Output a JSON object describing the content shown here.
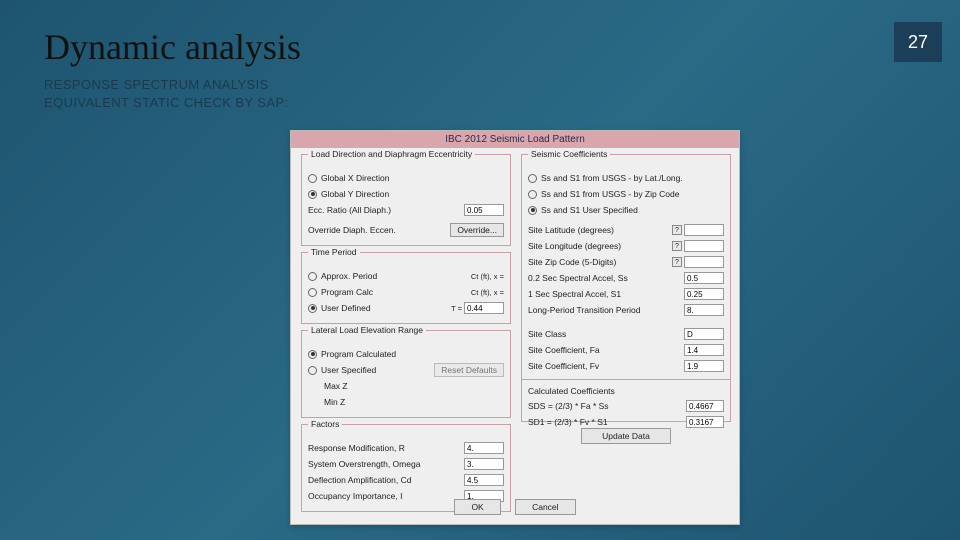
{
  "slide": {
    "title": "Dynamic analysis",
    "sub1": "RESPONSE SPECTRUM ANALYSIS",
    "sub2": "EQUIVALENT STATIC CHECK BY SAP:",
    "page": "27"
  },
  "dialog": {
    "title": "IBC 2012 Seismic Load Pattern",
    "left": {
      "dir_group": "Load Direction and Diaphragm Eccentricity",
      "dir_x": "Global X Direction",
      "dir_y": "Global Y Direction",
      "ecc_label": "Ecc. Ratio (All Diaph.)",
      "ecc_val": "0.05",
      "override_label": "Override Diaph. Eccen.",
      "override_btn": "Override...",
      "tp_group": "Time Period",
      "tp_approx": "Approx. Period",
      "tp_approx_hint": "Ct (ft), x =",
      "tp_prog": "Program Calc",
      "tp_prog_hint": "Ct (ft), x =",
      "tp_user": "User Defined",
      "tp_user_hint": "T =",
      "tp_user_val": "0.44",
      "lat_group": "Lateral Load Elevation Range",
      "lat_prog": "Program Calculated",
      "lat_user": "User Specified",
      "lat_reset": "Reset Defaults",
      "lat_max": "Max Z",
      "lat_min": "Min Z",
      "fac_group": "Factors",
      "fac_r_lbl": "Response Modification, R",
      "fac_r_val": "4.",
      "fac_o_lbl": "System Overstrength, Omega",
      "fac_o_val": "3.",
      "fac_cd_lbl": "Deflection Amplification, Cd",
      "fac_cd_val": "4.5",
      "fac_i_lbl": "Occupancy Importance, I",
      "fac_i_val": "1."
    },
    "right": {
      "sc_group": "Seismic Coefficients",
      "sc_latlong": "Ss and S1 from USGS - by Lat./Long.",
      "sc_zip": "Ss and S1 from USGS - by Zip Code",
      "sc_user": "Ss and S1 User Specified",
      "lat_lbl": "Site Latitude (degrees)",
      "lon_lbl": "Site Longitude (degrees)",
      "zip_lbl": "Site Zip Code (5-Digits)",
      "ss_lbl": "0.2 Sec Spectral Accel, Ss",
      "ss_val": "0.5",
      "s1_lbl": "1 Sec Spectral Accel, S1",
      "s1_val": "0.25",
      "tl_lbl": "Long-Period Transition Period",
      "tl_val": "8.",
      "siteclass_lbl": "Site Class",
      "siteclass_val": "D",
      "fa_lbl": "Site Coefficient, Fa",
      "fa_val": "1.4",
      "fv_lbl": "Site Coefficient, Fv",
      "fv_val": "1.9",
      "cc_group": "Calculated Coefficients",
      "sds_lbl": "SDS = (2/3) * Fa * Ss",
      "sds_val": "0.4667",
      "sd1_lbl": "SD1 = (2/3) * Fv * S1",
      "sd1_val": "0.3167",
      "update_btn": "Update Data"
    },
    "ok": "OK",
    "cancel": "Cancel"
  }
}
